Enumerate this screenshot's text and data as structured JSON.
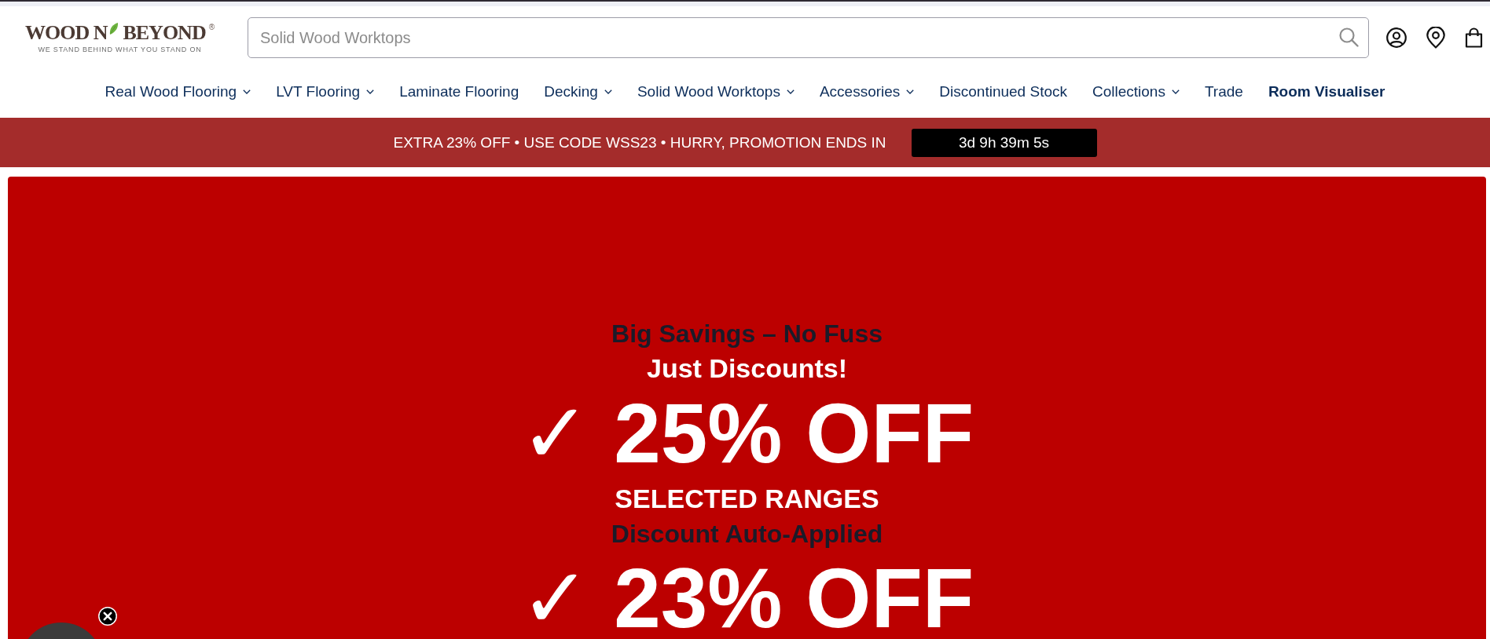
{
  "header": {
    "logo": {
      "wordmark_start": "WOOD N",
      "wordmark_end": "BEYOND$^{®}$",
      "tagline": "WE STAND BEHIND WHAT YOU STAND ON"
    },
    "search": {
      "placeholder": "Solid Wood Worktops"
    }
  },
  "nav": [
    {
      "label": "Real Wood Flooring",
      "has_menu": true,
      "highlighted": false
    },
    {
      "label": "LVT Flooring",
      "has_menu": true,
      "highlighted": false
    },
    {
      "label": "Laminate Flooring",
      "has_menu": false,
      "highlighted": false
    },
    {
      "label": "Decking",
      "has_menu": true,
      "highlighted": false
    },
    {
      "label": "Solid Wood Worktops",
      "has_menu": true,
      "highlighted": false
    },
    {
      "label": "Accessories",
      "has_menu": true,
      "highlighted": false
    },
    {
      "label": "Discontinued Stock",
      "has_menu": false,
      "highlighted": false
    },
    {
      "label": "Collections",
      "has_menu": true,
      "highlighted": false
    },
    {
      "label": "Trade",
      "has_menu": false,
      "highlighted": false
    },
    {
      "label": "Room Visualiser",
      "has_menu": false,
      "highlighted": true
    }
  ],
  "promo_bar": {
    "text": "EXTRA 23% OFF • USE CODE WSS23 • HURRY, PROMOTION ENDS IN",
    "countdown": "3d 9h 39m 5s"
  },
  "banner": {
    "lines": [
      {
        "kind": "heading",
        "text": "Big Savings – No Fuss"
      },
      {
        "kind": "subheading",
        "text": "Just Discounts!"
      },
      {
        "kind": "offer",
        "text": "✓ 25% OFF"
      },
      {
        "kind": "subheading",
        "text": "SELECTED RANGES"
      },
      {
        "kind": "heading",
        "text": "Discount Auto-Applied"
      },
      {
        "kind": "offer",
        "text": "✓ 23% OFF"
      }
    ]
  }
}
